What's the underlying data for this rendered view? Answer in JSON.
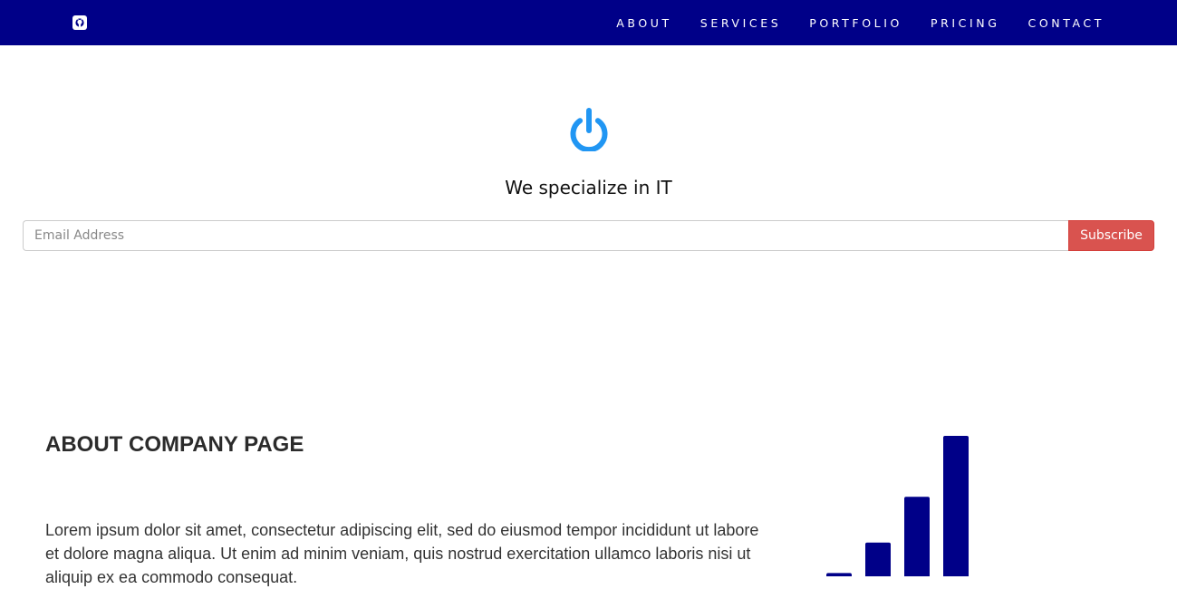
{
  "navbar": {
    "brand_icon": "github-icon",
    "background": "#000088",
    "items": [
      {
        "label": "ABOUT"
      },
      {
        "label": "SERVICES"
      },
      {
        "label": "PORTFOLIO"
      },
      {
        "label": "PRICING"
      },
      {
        "label": "CONTACT"
      }
    ]
  },
  "hero": {
    "icon": "power-icon",
    "icon_color": "#2196f3",
    "tagline": "We specialize in IT",
    "email_placeholder": "Email Address",
    "email_value": "",
    "subscribe_label": "Subscribe",
    "subscribe_color": "#d9534f"
  },
  "about": {
    "title": "ABOUT COMPANY PAGE",
    "text": "Lorem ipsum dolor sit amet, consectetur adipiscing elit, sed do eiusmod tempor incididunt ut labore et dolore magna aliqua. Ut enim ad minim veniam, quis nostrud exercitation ullamco laboris nisi ut aliquip ex ea commodo consequat."
  },
  "chart_data": {
    "type": "bar",
    "color": "#000088",
    "values": [
      1,
      2,
      4,
      7,
      11
    ],
    "grid": false,
    "axes_visible": false
  }
}
